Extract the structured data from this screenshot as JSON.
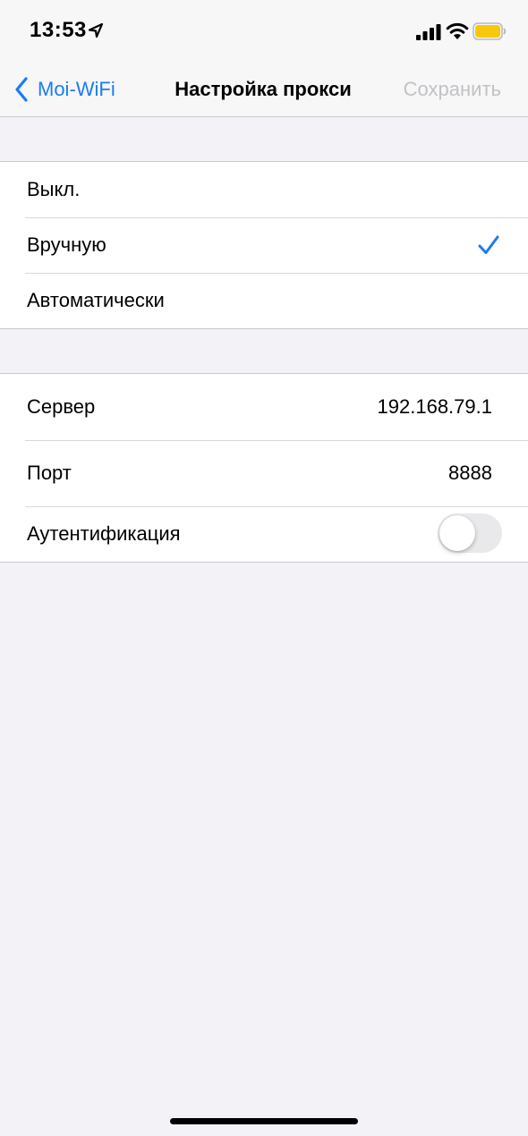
{
  "status_bar": {
    "time": "13:53",
    "icons": [
      "location-arrow-icon",
      "cellular-signal-icon",
      "wifi-icon",
      "battery-icon"
    ],
    "battery_color": "#f7c70a"
  },
  "nav": {
    "back_label": "Moi-WiFi",
    "title": "Настройка прокси",
    "save_label": "Сохранить"
  },
  "colors": {
    "accent": "#1a7cf5",
    "disabled": "#c2c2c6",
    "background": "#f2f2f7"
  },
  "proxy_modes": {
    "items": [
      {
        "label": "Выкл.",
        "selected": false
      },
      {
        "label": "Вручную",
        "selected": true
      },
      {
        "label": "Автоматически",
        "selected": false
      }
    ]
  },
  "proxy_settings": {
    "server_label": "Сервер",
    "server_value": "192.168.79.1",
    "port_label": "Порт",
    "port_value": "8888",
    "auth_label": "Аутентификация",
    "auth_enabled": false
  }
}
